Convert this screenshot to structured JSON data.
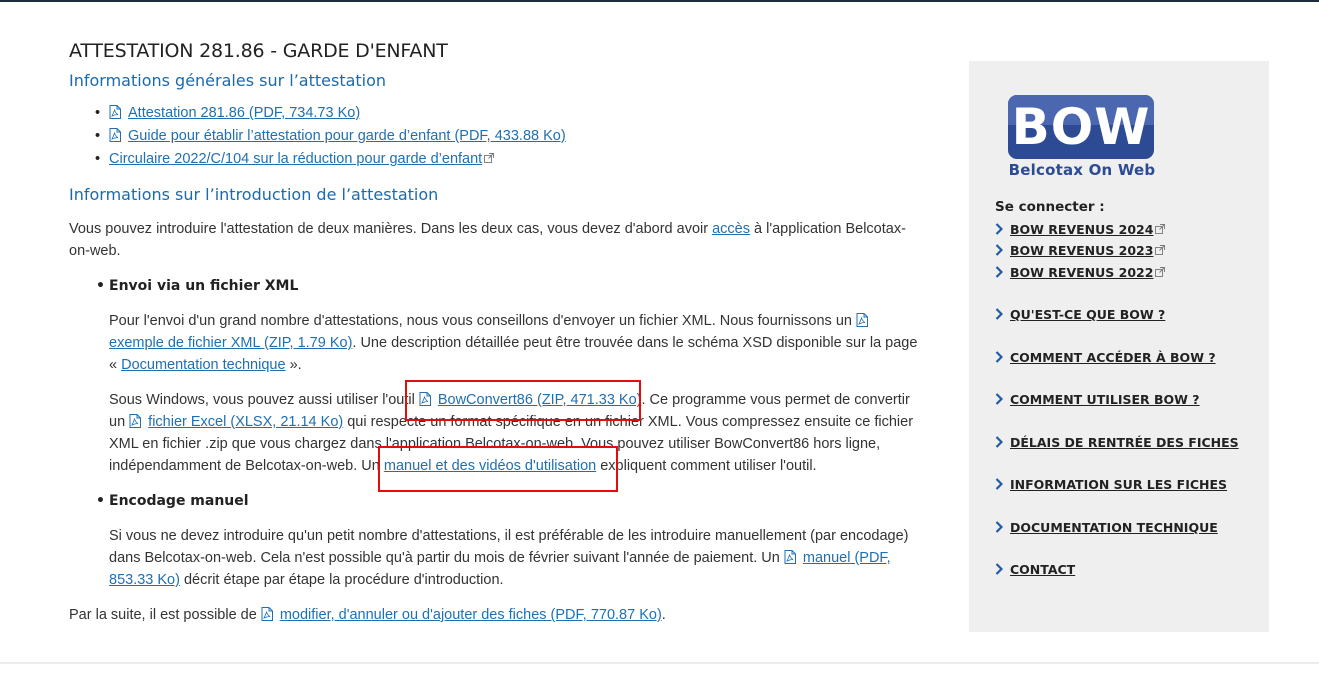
{
  "page": {
    "title": "ATTESTATION 281.86 - GARDE D'ENFANT"
  },
  "general": {
    "heading": "Informations générales sur l’attestation",
    "links": [
      {
        "label": "Attestation 281.86 (PDF, 734.73 Ko)",
        "icon": "pdf-icon"
      },
      {
        "label": "Guide pour établir l’attestation pour garde d’enfant (PDF, 433.88 Ko)",
        "icon": "pdf-icon"
      },
      {
        "label": "Circulaire 2022/C/104 sur la réduction pour garde d’enfant",
        "icon": "external-link-icon"
      }
    ]
  },
  "intro": {
    "heading": "Informations sur l’introduction de l’attestation",
    "p1_a": "Vous pouvez introduire l'attestation de deux manières. Dans les deux cas, vous devez d'abord avoir ",
    "p1_link": "accès",
    "p1_b": " à l'application Belcotax-on-web.",
    "xml": {
      "heading": "Envoi via un fichier XML",
      "p1_a": "Pour l'envoi d'un grand nombre d'attestations, nous vous conseillons d'envoyer un fichier XML. Nous fournissons un ",
      "p1_link": "exemple de fichier XML (ZIP, 1.79 Ko)",
      "p1_b": ". Une description détaillée peut être trouvée dans le schéma XSD disponible sur la page « ",
      "p1_link2": "Documentation technique",
      "p1_c": " ».",
      "p2_a": "Sous Windows, vous pouvez aussi utiliser l'outil ",
      "p2_link1": "BowConvert86 (ZIP, 471.33 Ko)",
      "p2_b": ". Ce programme vous permet de convertir un ",
      "p2_link2": "fichier Excel (XLSX, 21.14 Ko)",
      "p2_c": " qui respecte un format spécifique en un fichier XML. Vous compressez ensuite ce fichier XML en fichier .zip que vous chargez dans l'application Belcotax-on-web. Vous pouvez utiliser BowConvert86 hors ligne, indépendamment de Belcotax-on-web. Un ",
      "p2_link3": "manuel et des vidéos d'utilisation",
      "p2_d": " expliquent comment utiliser l'outil."
    },
    "manual": {
      "heading": "Encodage manuel",
      "p_a": "Si vous ne devez introduire qu'un petit nombre d'attestations, il est préférable de les introduire manuellement (par encodage) dans Belcotax-on-web. Cela n'est possible qu'à partir du mois de février suivant l'année de paiement. Un ",
      "p_link": "manuel (PDF, 853.33 Ko)",
      "p_b": " décrit étape par étape la procédure d'introduction."
    },
    "final_a": "Par la suite, il est possible de ",
    "final_link": "modifier, d'annuler ou d'ajouter des fiches (PDF, 770.87 Ko)",
    "final_b": "."
  },
  "sidebar": {
    "logo_text": "BOW",
    "logo_subtitle": "Belcotax On Web",
    "connect_title": "Se connecter :",
    "connect_links": [
      "BOW REVENUS 2024",
      "BOW REVENUS 2023",
      "BOW REVENUS 2022"
    ],
    "nav": [
      "QU'EST-CE QUE BOW ?",
      "COMMENT ACCÉDER À BOW ?",
      "COMMENT UTILISER BOW ?",
      "DÉLAIS DE RENTRÉE DES FICHES",
      "INFORMATION SUR LES FICHES",
      "DOCUMENTATION TECHNIQUE",
      "CONTACT"
    ]
  },
  "colors": {
    "link": "#1f6fb3",
    "heading_blue": "#1b6aad",
    "highlight_box": "#e30d0d",
    "logo_blue": "#2d4a94",
    "sidebar_bg": "#efefef"
  }
}
